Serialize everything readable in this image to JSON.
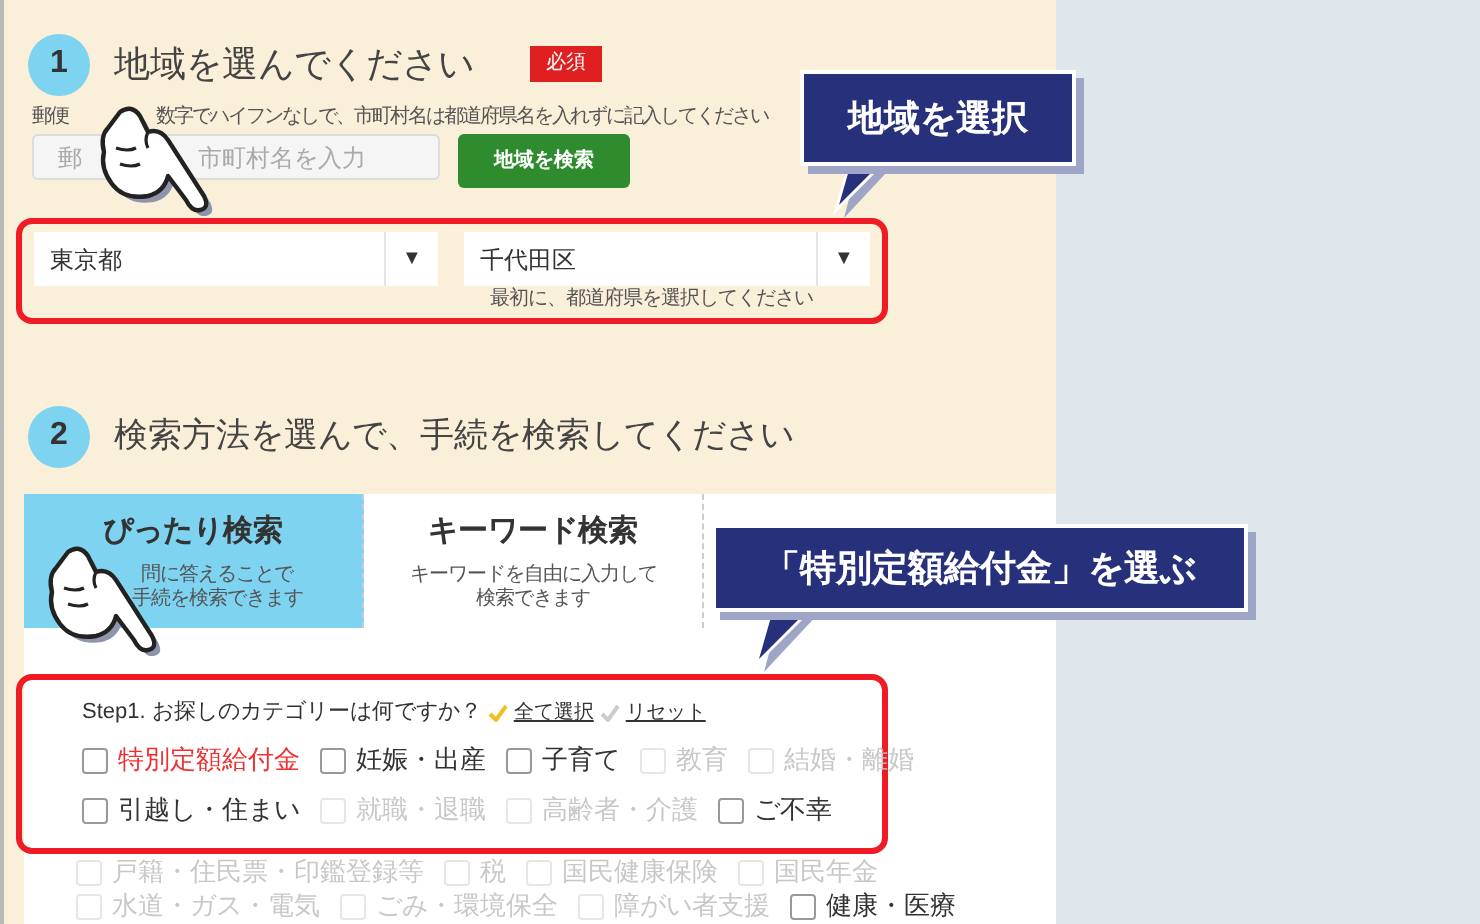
{
  "section1": {
    "number": "1",
    "title": "地域を選んでください",
    "badge": "必須",
    "hint_parts": [
      "郵便",
      "数字でハイフンなしで、市町村名は都道府県名を入れずに記入してください"
    ],
    "input_placeholder_parts": [
      "郵",
      "市町村名を入力"
    ],
    "search_button": "地域を検索",
    "selects": [
      {
        "value": "東京都",
        "arrow": "▼"
      },
      {
        "value": "千代田区",
        "arrow": "▼"
      }
    ],
    "select_note": "最初に、都道府県を選択してください"
  },
  "section2": {
    "number": "2",
    "title": "検索方法を選んで、手続を検索してください"
  },
  "tabs": [
    {
      "label": "ぴったり検索",
      "description_parts": [
        "問に答えることで",
        "手続を検索できます"
      ],
      "selected": true
    },
    {
      "label": "キーワード検索",
      "description_parts": [
        "キーワードを自由に入力して",
        "検索できます"
      ],
      "selected": false
    }
  ],
  "step": {
    "label": "Step1. お探しのカテゴリーは何ですか？",
    "select_all": "全て選択",
    "reset": "リセット"
  },
  "category_rows": [
    [
      {
        "label": "特別定額給付金",
        "disabled": false,
        "highlighted": true
      },
      {
        "label": "妊娠・出産",
        "disabled": false,
        "highlighted": false
      },
      {
        "label": "子育て",
        "disabled": false,
        "highlighted": false
      },
      {
        "label": "教育",
        "disabled": true,
        "highlighted": false
      },
      {
        "label": "結婚・離婚",
        "disabled": true,
        "highlighted": false
      }
    ],
    [
      {
        "label": "引越し・住まい",
        "disabled": false,
        "highlighted": false
      },
      {
        "label": "就職・退職",
        "disabled": true,
        "highlighted": false
      },
      {
        "label": "高齢者・介護",
        "disabled": true,
        "highlighted": false
      },
      {
        "label": "ご不幸",
        "disabled": false,
        "highlighted": false
      }
    ],
    [
      {
        "label": "戸籍・住民票・印鑑登録等",
        "disabled": true,
        "highlighted": false
      },
      {
        "label": "税",
        "disabled": true,
        "highlighted": false
      },
      {
        "label": "国民健康保険",
        "disabled": true,
        "highlighted": false
      },
      {
        "label": "国民年金",
        "disabled": true,
        "highlighted": false
      }
    ],
    [
      {
        "label": "水道・ガス・電気",
        "disabled": true,
        "highlighted": false
      },
      {
        "label": "ごみ・環境保全",
        "disabled": true,
        "highlighted": false
      },
      {
        "label": "障がい者支援",
        "disabled": true,
        "highlighted": false
      },
      {
        "label": "健康・医療",
        "disabled": false,
        "highlighted": false
      }
    ]
  ],
  "callouts": [
    {
      "text": "地域を選択"
    },
    {
      "text": "「特別定額給付金」を選ぶ"
    }
  ]
}
